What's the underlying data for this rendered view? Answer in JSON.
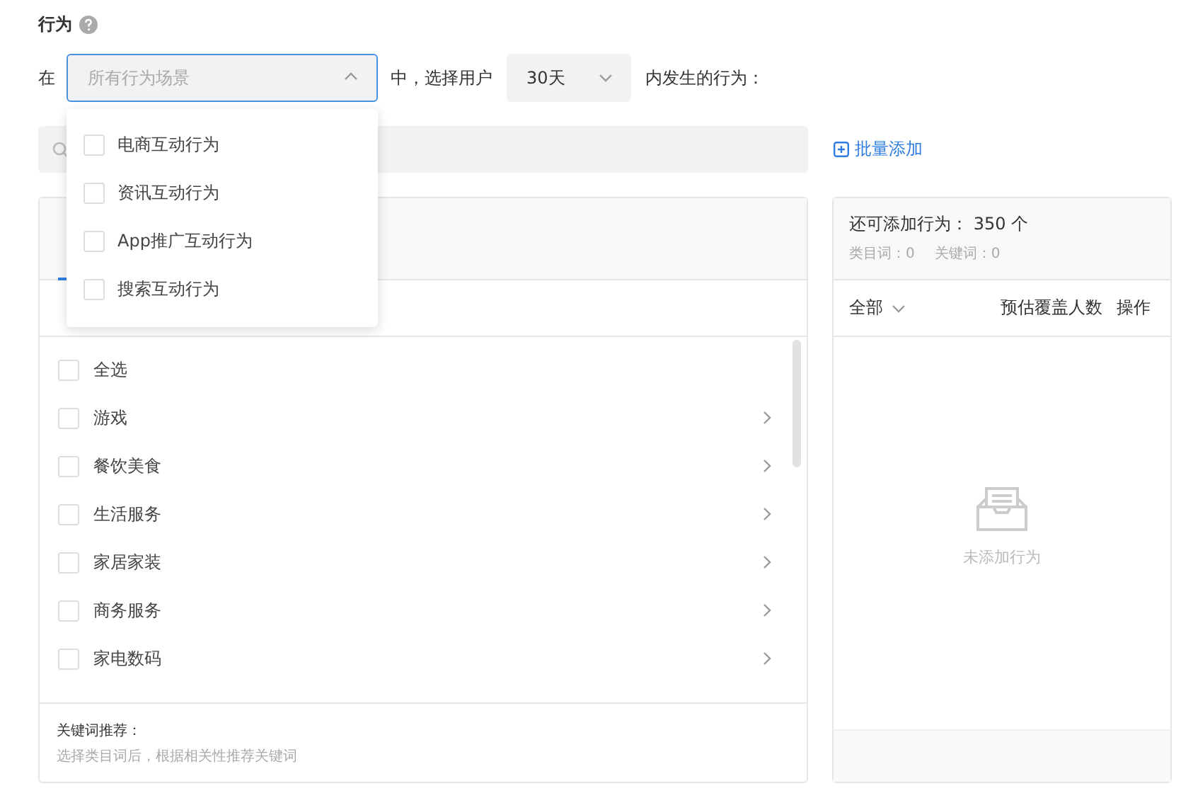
{
  "section": {
    "title": "行为"
  },
  "filter": {
    "prefix": "在",
    "scene_select": {
      "placeholder": "所有行为场景",
      "expanded": true
    },
    "middle": "中，选择用户",
    "period_select": {
      "value": "30天"
    },
    "suffix": "内发生的行为："
  },
  "scene_options": [
    {
      "label": "电商互动行为",
      "checked": false
    },
    {
      "label": "资讯互动行为",
      "checked": false
    },
    {
      "label": "App推广互动行为",
      "checked": false
    },
    {
      "label": "搜索互动行为",
      "checked": false
    }
  ],
  "batch_add": {
    "label": "批量添加"
  },
  "left_panel": {
    "items": [
      {
        "label": "全选",
        "checked": false,
        "has_children": false
      },
      {
        "label": "游戏",
        "checked": false,
        "has_children": true
      },
      {
        "label": "餐饮美食",
        "checked": false,
        "has_children": true
      },
      {
        "label": "生活服务",
        "checked": false,
        "has_children": true
      },
      {
        "label": "家居家装",
        "checked": false,
        "has_children": true
      },
      {
        "label": "商务服务",
        "checked": false,
        "has_children": true
      },
      {
        "label": "家电数码",
        "checked": false,
        "has_children": true
      }
    ],
    "footer_title": "关键词推荐：",
    "footer_hint": "选择类目词后，根据相关性推荐关键词"
  },
  "right_panel": {
    "remaining": "还可添加行为： 350 个",
    "category_count": "类目词：0",
    "keyword_count": "关键词：0",
    "columns": [
      "全部",
      "预估覆盖人数",
      "操作"
    ],
    "empty_text": "未添加行为"
  }
}
